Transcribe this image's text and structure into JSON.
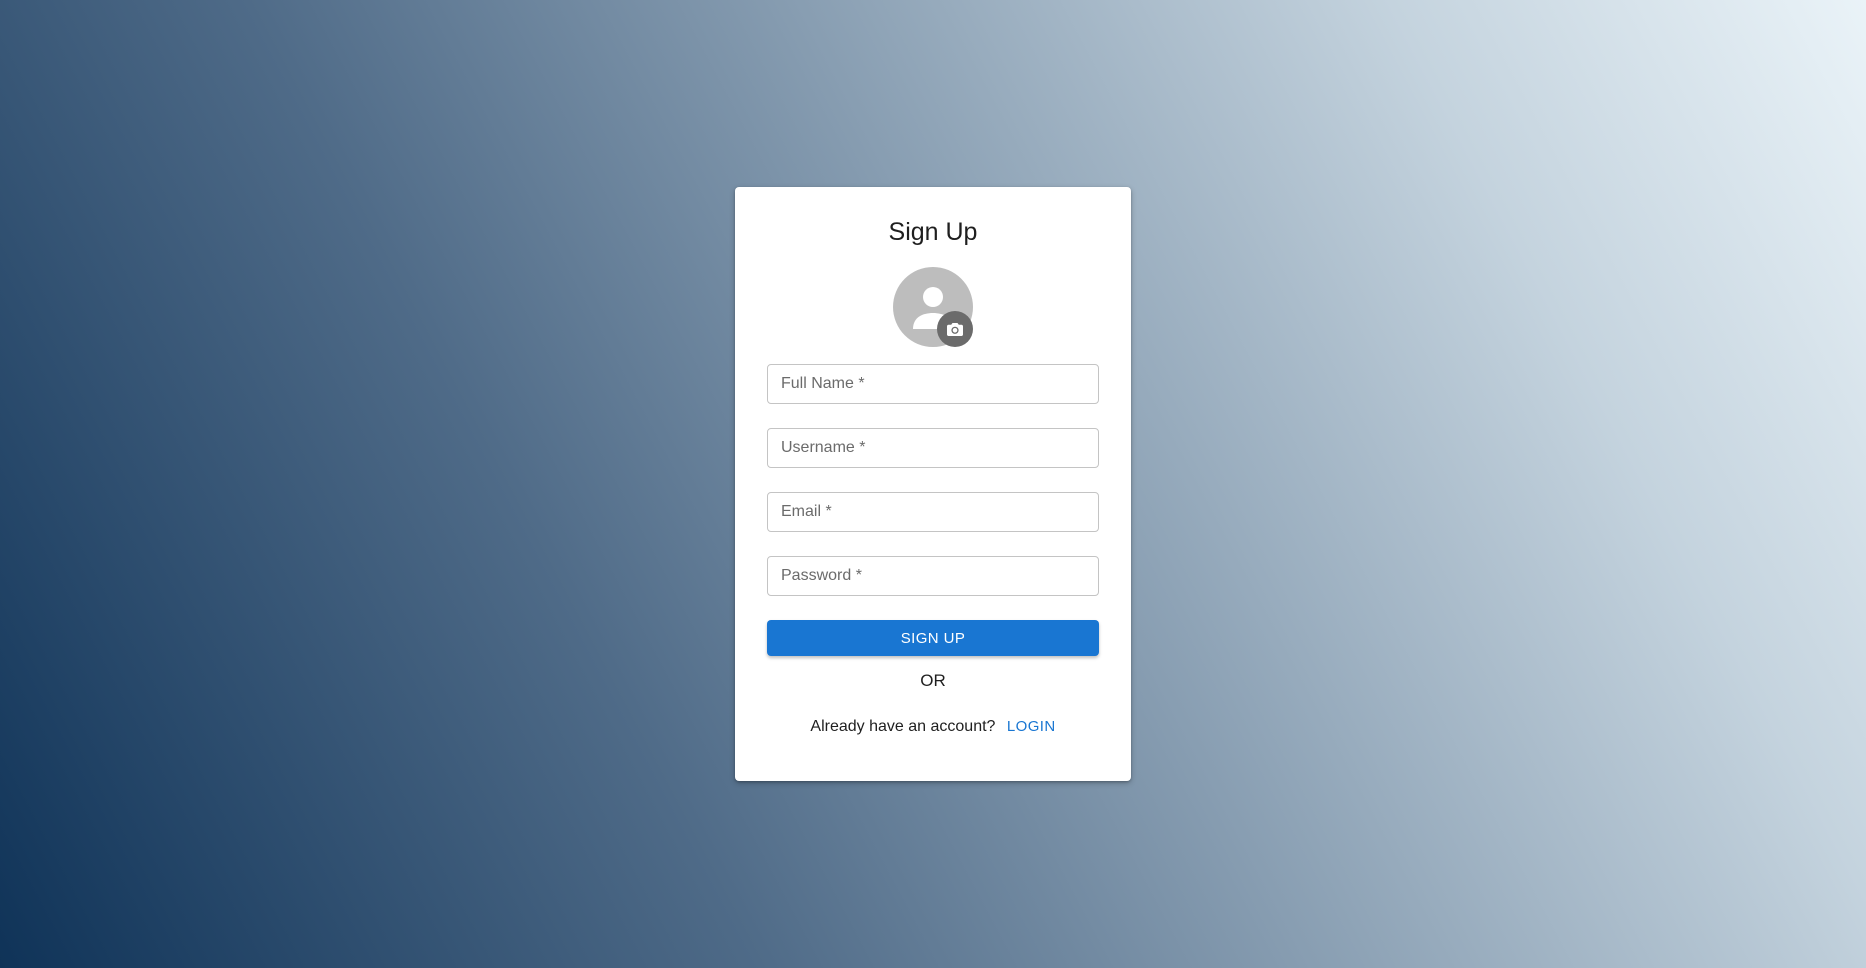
{
  "form": {
    "title": "Sign Up",
    "fields": [
      {
        "placeholder": "Full Name *"
      },
      {
        "placeholder": "Username *"
      },
      {
        "placeholder": "Email *"
      },
      {
        "placeholder": "Password *"
      }
    ],
    "submit_label": "SIGN UP",
    "divider_text": "OR",
    "account_prompt": "Already have an account?",
    "login_label": "LOGIN"
  },
  "icons": {
    "avatar": "person-icon",
    "upload": "camera-icon"
  },
  "colors": {
    "primary": "#1976d2",
    "avatar_bg": "#bdbdbd",
    "camera_bg": "#6b6b6b"
  }
}
